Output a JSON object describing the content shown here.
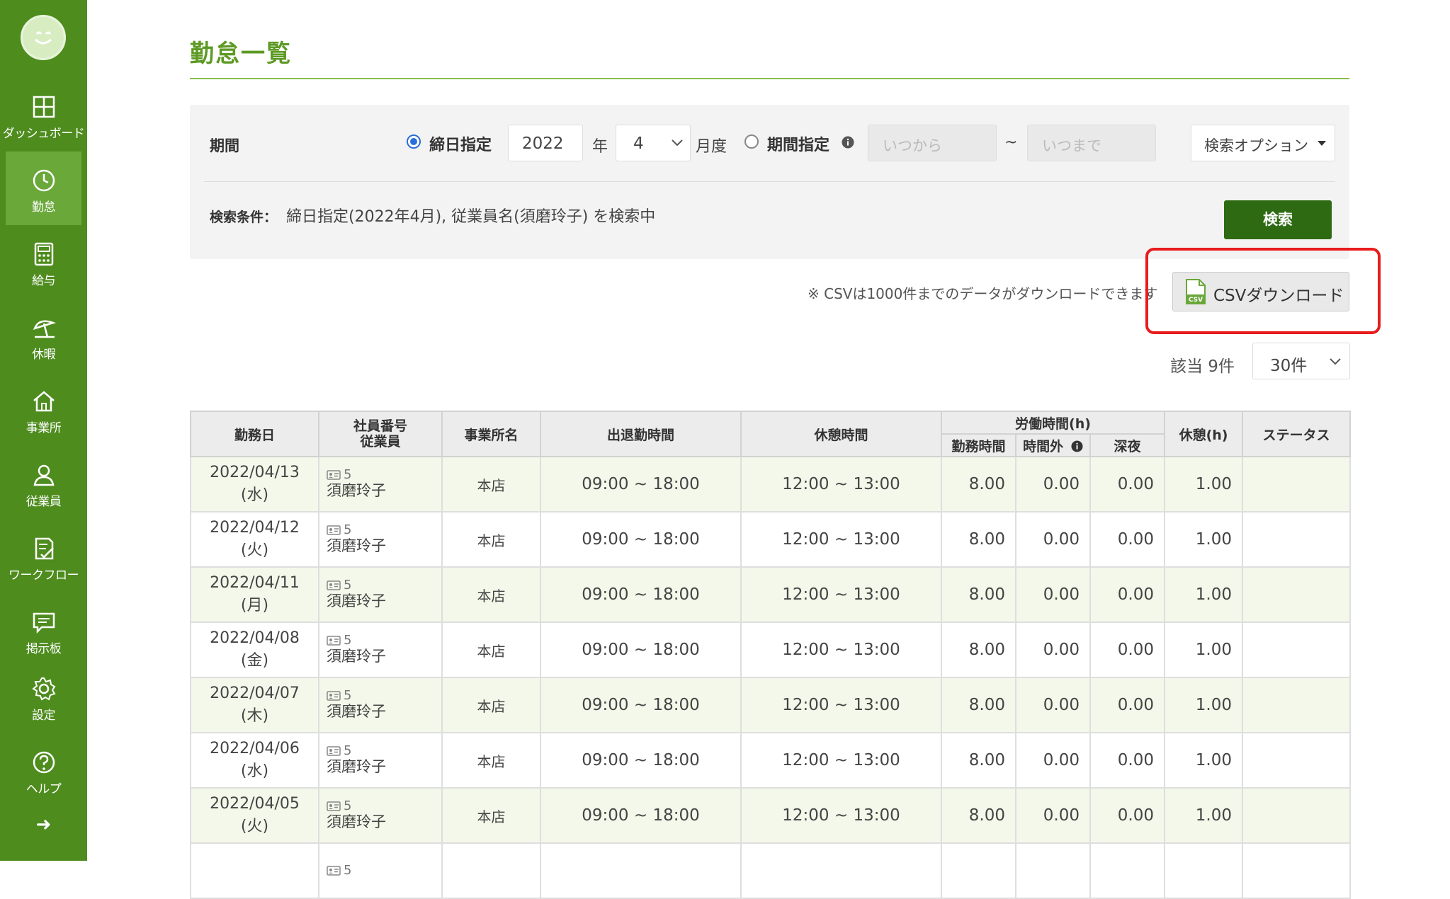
{
  "sidebar": {
    "items": [
      {
        "label": "ダッシュボード",
        "icon": "grid-icon"
      },
      {
        "label": "勤怠",
        "icon": "clock-icon",
        "active": true
      },
      {
        "label": "給与",
        "icon": "calculator-icon"
      },
      {
        "label": "休暇",
        "icon": "beach-umbrella-icon"
      },
      {
        "label": "事業所",
        "icon": "home-icon"
      },
      {
        "label": "従業員",
        "icon": "person-icon"
      },
      {
        "label": "ワークフロー",
        "icon": "checklist-icon"
      },
      {
        "label": "掲示板",
        "icon": "chat-icon"
      },
      {
        "label": "設定",
        "icon": "gear-icon"
      },
      {
        "label": "ヘルプ",
        "icon": "help-icon"
      }
    ],
    "expand_icon": "arrow-right-icon"
  },
  "page": {
    "title": "勤怠一覧"
  },
  "search": {
    "period_label": "期間",
    "closing_radio_label": "締日指定",
    "year_value": "2022",
    "year_suffix": "年",
    "month_value": "4",
    "month_suffix": "月度",
    "range_radio_label": "期間指定",
    "from_placeholder": "いつから",
    "range_sep": "~",
    "to_placeholder": "いつまで",
    "options_button": "検索オプション",
    "conditions_label": "検索条件：",
    "conditions_text": "締日指定(2022年4月), 従業員名(須磨玲子) を検索中",
    "search_button": "検索"
  },
  "csv": {
    "note": "※ CSVは1000件までのデータがダウンロードできます",
    "button_label": "CSVダウンロード"
  },
  "results": {
    "count_text": "該当 9件",
    "per_page": "30件"
  },
  "table": {
    "headers": {
      "date": "勤務日",
      "emp_no": "社員番号",
      "emp": "従業員",
      "office": "事業所名",
      "inout": "出退勤時間",
      "break": "休憩時間",
      "labor_group": "労働時間(h)",
      "work": "勤務時間",
      "overtime": "時間外",
      "night": "深夜",
      "rest": "休憩(h)",
      "status": "ステータス"
    },
    "rows": [
      {
        "date": "2022/04/13",
        "dow": "(水)",
        "emp_no": "5",
        "name": "須磨玲子",
        "office": "本店",
        "inout": "09:00 ~ 18:00",
        "break": "12:00 ~ 13:00",
        "work": "8.00",
        "overtime": "0.00",
        "night": "0.00",
        "rest": "1.00",
        "status": ""
      },
      {
        "date": "2022/04/12",
        "dow": "(火)",
        "emp_no": "5",
        "name": "須磨玲子",
        "office": "本店",
        "inout": "09:00 ~ 18:00",
        "break": "12:00 ~ 13:00",
        "work": "8.00",
        "overtime": "0.00",
        "night": "0.00",
        "rest": "1.00",
        "status": ""
      },
      {
        "date": "2022/04/11",
        "dow": "(月)",
        "emp_no": "5",
        "name": "須磨玲子",
        "office": "本店",
        "inout": "09:00 ~ 18:00",
        "break": "12:00 ~ 13:00",
        "work": "8.00",
        "overtime": "0.00",
        "night": "0.00",
        "rest": "1.00",
        "status": ""
      },
      {
        "date": "2022/04/08",
        "dow": "(金)",
        "emp_no": "5",
        "name": "須磨玲子",
        "office": "本店",
        "inout": "09:00 ~ 18:00",
        "break": "12:00 ~ 13:00",
        "work": "8.00",
        "overtime": "0.00",
        "night": "0.00",
        "rest": "1.00",
        "status": ""
      },
      {
        "date": "2022/04/07",
        "dow": "(木)",
        "emp_no": "5",
        "name": "須磨玲子",
        "office": "本店",
        "inout": "09:00 ~ 18:00",
        "break": "12:00 ~ 13:00",
        "work": "8.00",
        "overtime": "0.00",
        "night": "0.00",
        "rest": "1.00",
        "status": ""
      },
      {
        "date": "2022/04/06",
        "dow": "(水)",
        "emp_no": "5",
        "name": "須磨玲子",
        "office": "本店",
        "inout": "09:00 ~ 18:00",
        "break": "12:00 ~ 13:00",
        "work": "8.00",
        "overtime": "0.00",
        "night": "0.00",
        "rest": "1.00",
        "status": ""
      },
      {
        "date": "2022/04/05",
        "dow": "(火)",
        "emp_no": "5",
        "name": "須磨玲子",
        "office": "本店",
        "inout": "09:00 ~ 18:00",
        "break": "12:00 ~ 13:00",
        "work": "8.00",
        "overtime": "0.00",
        "night": "0.00",
        "rest": "1.00",
        "status": ""
      },
      {
        "date": "",
        "dow": "",
        "emp_no": "5",
        "name": "",
        "office": "",
        "inout": "",
        "break": "",
        "work": "",
        "overtime": "",
        "night": "",
        "rest": "",
        "status": ""
      }
    ]
  },
  "colors": {
    "sidebar": "#4e8c1e",
    "accent": "#5d9a24",
    "search_button": "#2e6a12",
    "highlight": "#e81c1c"
  }
}
